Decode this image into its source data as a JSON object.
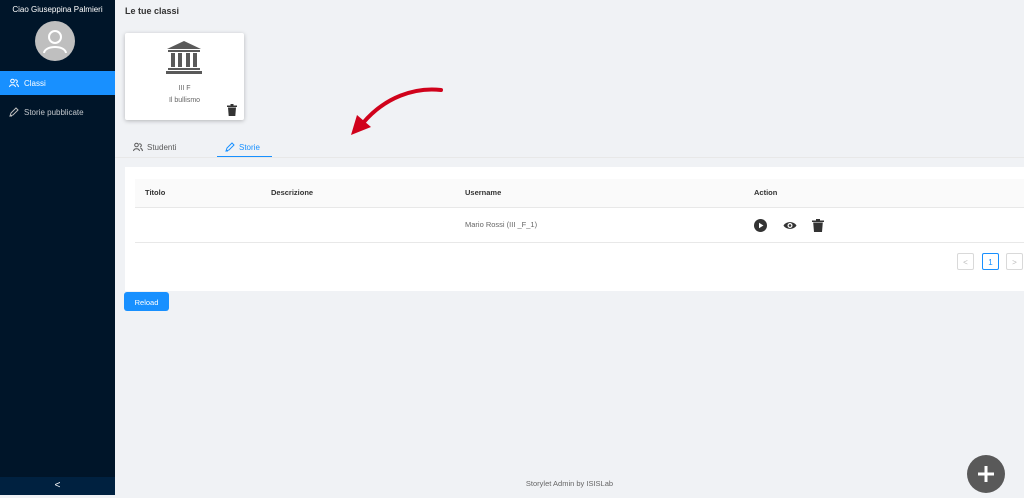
{
  "sidebar": {
    "greeting": "Ciao Giuseppina Palmieri",
    "avatar_icon": "user-icon",
    "items": [
      {
        "label": "Classi",
        "icon": "team-icon",
        "active": true
      },
      {
        "label": "Storie pubblicate",
        "icon": "edit-icon",
        "active": false
      }
    ],
    "collapse_glyph": "<"
  },
  "main": {
    "title": "Le tue classi",
    "classes": [
      {
        "name": "III F",
        "subtitle": "Il bullismo",
        "icon": "bank-icon"
      }
    ],
    "tabs": [
      {
        "label": "Studenti",
        "icon": "team-icon",
        "active": false
      },
      {
        "label": "Storie",
        "icon": "edit-icon",
        "active": true
      }
    ],
    "table": {
      "columns": [
        "Titolo",
        "Descrizione",
        "Username",
        "Action"
      ],
      "rows": [
        {
          "titolo": "",
          "descrizione": "",
          "username": "Mario Rossi (III _F_1)",
          "actions": [
            "play-icon",
            "eye-icon",
            "delete-icon"
          ]
        }
      ]
    },
    "pagination": {
      "prev": "<",
      "current": "1",
      "next": ">"
    },
    "reload_label": "Reload",
    "fab_glyph": "+"
  },
  "footer": {
    "text": "Storylet Admin by ISISLab"
  },
  "colors": {
    "sidebar": "#001529",
    "accent": "#1890ff",
    "annotation_arrow": "#d0021b"
  }
}
